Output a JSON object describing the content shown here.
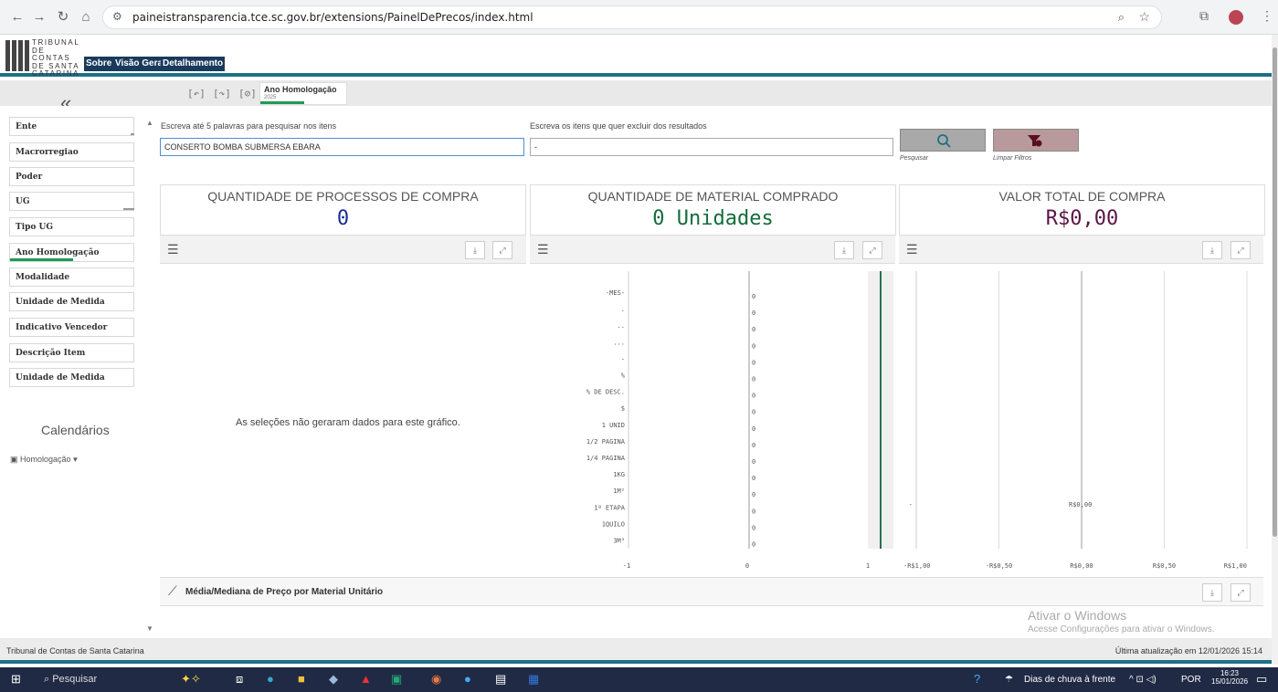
{
  "browser": {
    "url": "paineistransparencia.tce.sc.gov.br/extensions/PainelDePrecos/index.html"
  },
  "header": {
    "logo_lines": [
      "TRIBUNAL",
      "DE CONTAS",
      "DE SANTA",
      "CATARINA"
    ],
    "tabs": [
      "Sobre",
      "Visão Geral",
      "Detalhamento"
    ]
  },
  "selection": {
    "chip_title": "Ano Homologação",
    "chip_value": "2025"
  },
  "sidebar": {
    "toggle": "«",
    "filters": [
      "Ente",
      "Macrorregiao",
      "Poder",
      "UG",
      "Tipo UG",
      "Ano Homologação",
      "Modalidade",
      "Unidade de Medida",
      "Indicativo Vencedor",
      "Descrição Item",
      "Unidade de Medida"
    ],
    "calendar_title": "Calendários",
    "calendar_item": "Homologação"
  },
  "search": {
    "include_label": "Escreva até 5 palavras para pesquisar nos itens",
    "include_value": "CONSERTO BOMBA SUBMERSA EBARA",
    "exclude_label": "Escreva os itens que quer excluir dos resultados",
    "exclude_value": "-",
    "search_button_label": "Pesquisar",
    "clear_button_label": "Limpar Filtros"
  },
  "kpis": [
    {
      "title": "QUANTIDADE DE PROCESSOS DE COMPRA",
      "value": "0",
      "color": "#1a2a9c"
    },
    {
      "title": "QUANTIDADE DE MATERIAL COMPRADO",
      "value": "0 Unidades",
      "color": "#146b3a"
    },
    {
      "title": "VALOR TOTAL DE COMPRA",
      "value": "R$0,00",
      "color": "#5a1548"
    }
  ],
  "charts": {
    "no_data_message": "As seleções não geraram dados para este gráfico."
  },
  "chart_data": [
    {
      "type": "bar",
      "categories": [
        "-MES-",
        ".",
        "..",
        "...",
        "-",
        "%",
        "% DE DESC.",
        "$",
        "1 UNID",
        "1/2 PAGINA",
        "1/4 PAGINA",
        "1KG",
        "1M²",
        "1º ETAPA",
        "1QUILO",
        "3M³"
      ],
      "values": [
        0,
        0,
        0,
        0,
        0,
        0,
        0,
        0,
        0,
        0,
        0,
        0,
        0,
        0,
        0,
        0
      ],
      "data_labels": [
        "0",
        "0",
        "0",
        "0",
        "0",
        "0",
        "0",
        "0",
        "0",
        "0",
        "0",
        "0",
        "0",
        "0",
        "0",
        "0"
      ],
      "xticks": [
        "-1",
        "0",
        "1"
      ],
      "xlim": [
        -1,
        1
      ]
    },
    {
      "type": "bar",
      "categories": [
        "-"
      ],
      "values": [
        0
      ],
      "data_labels": [
        "R$0,00"
      ],
      "xticks": [
        "-R$1,00",
        "-R$0,50",
        "R$0,00",
        "R$0,50",
        "R$1,00"
      ],
      "xlim": [
        -1,
        1
      ]
    }
  ],
  "bottom_panel": {
    "title": "Média/Mediana de Preço por Material Unitário"
  },
  "watermark": {
    "line1": "Ativar o Windows",
    "line2": "Acesse Configurações para ativar o Windows."
  },
  "footer": {
    "left": "Tribunal de Contas de Santa Catarina",
    "right": "Última atualização em 12/01/2026 15:14"
  },
  "taskbar": {
    "search": "Pesquisar",
    "weather": "Dias de chuva à frente",
    "lang": "POR",
    "time": "16:23",
    "date": "15/01/2026"
  }
}
